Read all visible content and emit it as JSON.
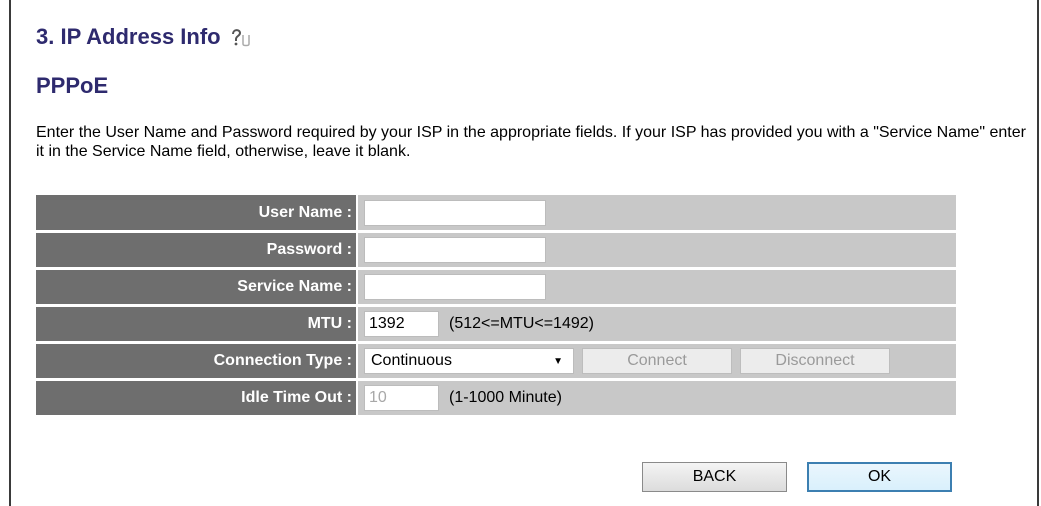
{
  "section": {
    "title": "3. IP Address Info",
    "subtitle": "PPPoE",
    "description": "Enter the User Name and Password required by your ISP in the appropriate fields. If your ISP has provided you with a \"Service Name\" enter it in the Service Name field, otherwise, leave it blank.",
    "help_icon": "help-icon"
  },
  "form": {
    "user_name_label": "User Name :",
    "user_name_value": "",
    "password_label": "Password :",
    "password_value": "",
    "service_name_label": "Service Name :",
    "service_name_value": "",
    "mtu_label": "MTU :",
    "mtu_value": "1392",
    "mtu_hint": "(512<=MTU<=1492)",
    "connection_type_label": "Connection Type :",
    "connection_type_value": "Continuous",
    "connect_label": "Connect",
    "disconnect_label": "Disconnect",
    "idle_timeout_label": "Idle Time Out :",
    "idle_timeout_value": "10",
    "idle_timeout_hint": "(1-1000 Minute)"
  },
  "actions": {
    "back_label": "BACK",
    "ok_label": "OK"
  },
  "colors": {
    "heading": "#2e2a6e",
    "label_bg": "#6e6e6e",
    "value_bg": "#c8c8c8"
  }
}
